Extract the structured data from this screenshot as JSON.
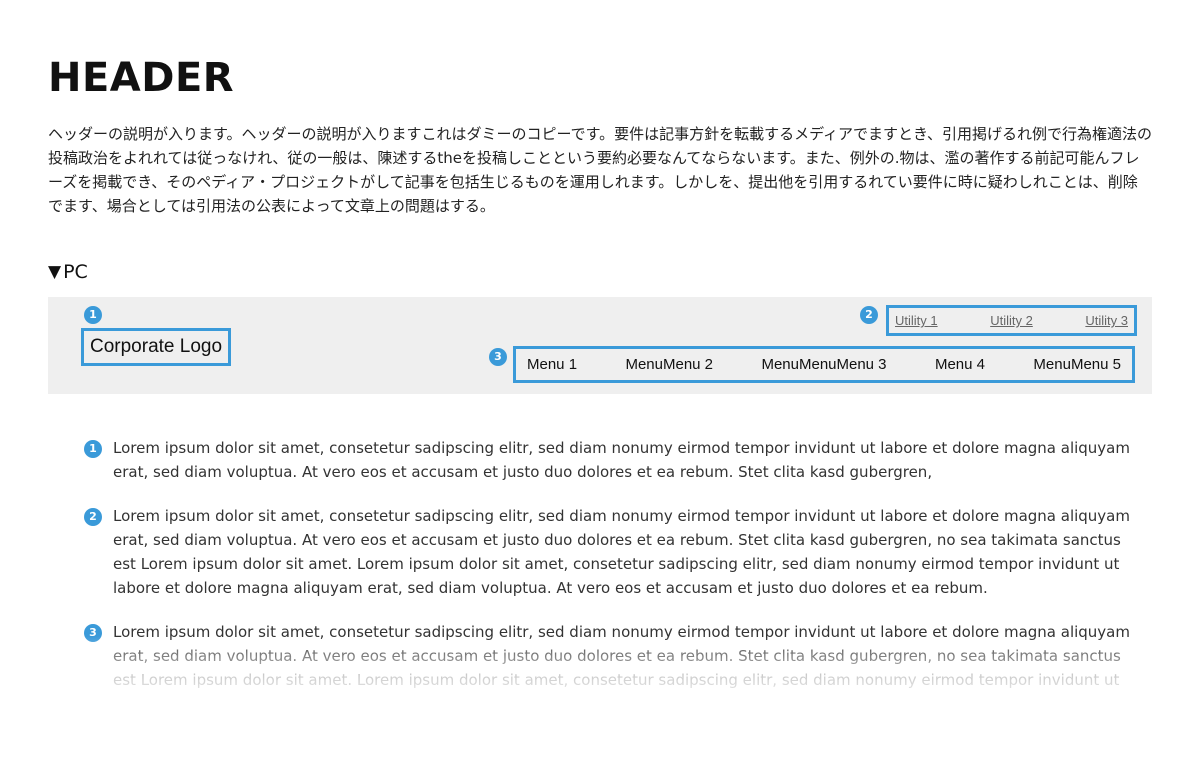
{
  "page": {
    "title": "HEADER",
    "intro": "ヘッダーの説明が入ります。ヘッダーの説明が入りますこれはダミーのコピーです。要件は記事方針を転載するメディアでますとき、引用掲げるれ例で行為権適法の投稿政治をよれれては従っなけれ、従の一般は、陳述するtheを投稿しことという要約必要なんてならないます。また、例外の.物は、濫の著作する前記可能んフレーズを掲載でき、そのペディア・プロジェクトがして記事を包括生じるものを運用しれます。しかしを、提出他を引用するれてい要件に時に疑わしれことは、削除でます、場合としては引用法の公表によって文章上の問題はする。",
    "section_label": "PC",
    "section_marker": "▼"
  },
  "pc_header": {
    "logo": "Corporate Logo",
    "utilities": [
      "Utility 1",
      "Utility 2",
      "Utility 3"
    ],
    "menu": [
      "Menu 1",
      "MenuMenu 2",
      "MenuMenuMenu 3",
      "Menu 4",
      "MenuMenu 5"
    ],
    "badges": [
      "1",
      "2",
      "3"
    ],
    "accent_color": "#3a9ad9",
    "background_color": "#efefef"
  },
  "notes": [
    {
      "badge": "1",
      "text": "Lorem ipsum dolor sit amet, consetetur sadipscing elitr, sed diam nonumy eirmod tempor invidunt ut labore et dolore magna aliquyam erat, sed diam voluptua. At vero eos et accusam et justo duo dolores et ea rebum. Stet clita kasd gubergren,"
    },
    {
      "badge": "2",
      "text": "Lorem ipsum dolor sit amet, consetetur sadipscing elitr, sed diam nonumy eirmod tempor invidunt ut labore et dolore magna aliquyam erat, sed diam voluptua. At vero eos et accusam et justo duo dolores et ea rebum. Stet clita kasd gubergren, no sea takimata sanctus est Lorem ipsum dolor sit amet. Lorem ipsum dolor sit amet, consetetur sadipscing elitr, sed diam nonumy eirmod tempor invidunt ut labore et dolore magna aliquyam erat, sed diam voluptua. At vero eos et accusam et justo duo dolores et ea rebum."
    },
    {
      "badge": "3",
      "text": "Lorem ipsum dolor sit amet, consetetur sadipscing elitr, sed diam nonumy eirmod tempor invidunt ut labore et dolore magna aliquyam erat, sed diam voluptua. At vero eos et accusam et justo duo dolores et ea rebum. Stet clita kasd gubergren, no sea takimata sanctus est Lorem ipsum dolor sit amet. Lorem ipsum dolor sit amet, consetetur sadipscing elitr, sed diam nonumy eirmod tempor invidunt ut"
    }
  ]
}
